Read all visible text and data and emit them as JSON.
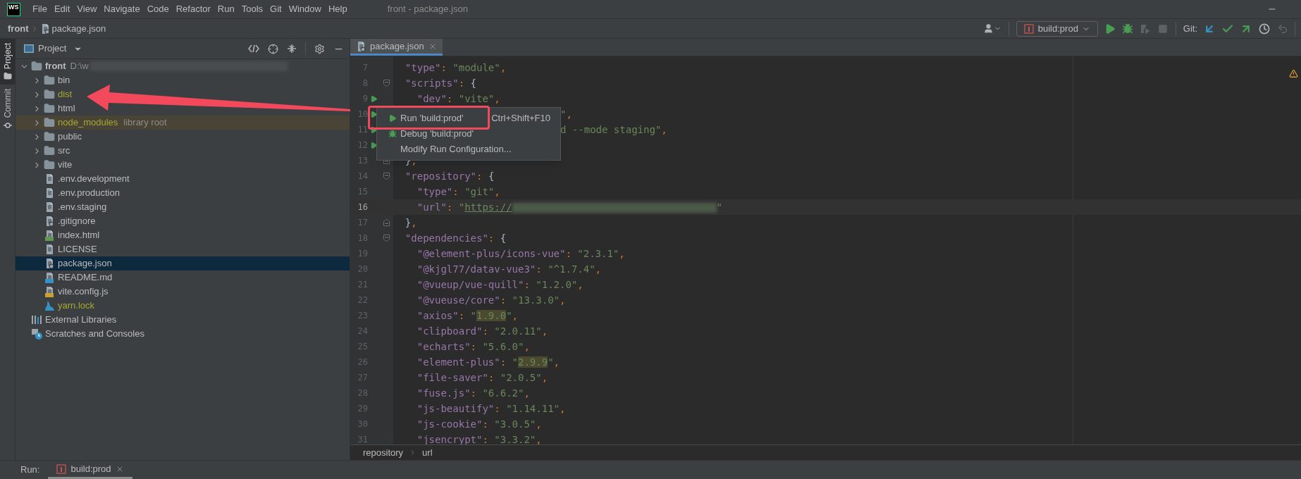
{
  "title_bar": {
    "logo": "WS",
    "menu": [
      "File",
      "Edit",
      "View",
      "Navigate",
      "Code",
      "Refactor",
      "Run",
      "Tools",
      "Git",
      "Window",
      "Help"
    ],
    "title": "front - package.json"
  },
  "nav_bar": {
    "breadcrumb": [
      "front",
      "package.json"
    ],
    "run_config": "build:prod",
    "git_label": "Git:",
    "actions": [
      {
        "kind": "run",
        "disabled": false
      },
      {
        "kind": "debug",
        "disabled": false
      },
      {
        "kind": "coverage",
        "disabled": true
      },
      {
        "kind": "stop",
        "disabled": true
      }
    ],
    "git_actions": [
      {
        "kind": "update",
        "disabled": false
      },
      {
        "kind": "commit",
        "disabled": false
      },
      {
        "kind": "push",
        "disabled": false
      },
      {
        "kind": "history",
        "disabled": false
      },
      {
        "kind": "rollback",
        "disabled": true
      }
    ]
  },
  "tool_windows": [
    {
      "label": "Project",
      "selected": true
    },
    {
      "label": "Commit",
      "selected": false
    }
  ],
  "project_panel": {
    "title": "Project",
    "tree": [
      {
        "label": "front",
        "kind": "root",
        "path": "D:\\w",
        "expanded": true,
        "selected": false,
        "ignored": false,
        "children": [
          {
            "label": "bin",
            "kind": "folder",
            "expanded": false,
            "selected": false,
            "ignored": false
          },
          {
            "label": "dist",
            "kind": "folder",
            "expanded": false,
            "selected": false,
            "ignored": true
          },
          {
            "label": "html",
            "kind": "folder",
            "expanded": false,
            "selected": false,
            "ignored": false
          },
          {
            "label": "node_modules",
            "kind": "folder",
            "expanded": false,
            "selected": false,
            "ignored": true,
            "note": "library root"
          },
          {
            "label": "public",
            "kind": "folder",
            "expanded": false,
            "selected": false,
            "ignored": false
          },
          {
            "label": "src",
            "kind": "folder",
            "expanded": false,
            "selected": false,
            "ignored": false
          },
          {
            "label": "vite",
            "kind": "folder",
            "expanded": false,
            "selected": false,
            "ignored": false
          },
          {
            "label": ".env.development",
            "kind": "text",
            "selected": false,
            "ignored": false
          },
          {
            "label": ".env.production",
            "kind": "text",
            "selected": false,
            "ignored": false
          },
          {
            "label": ".env.staging",
            "kind": "text",
            "selected": false,
            "ignored": false
          },
          {
            "label": ".gitignore",
            "kind": "gitignore",
            "selected": false,
            "ignored": false
          },
          {
            "label": "index.html",
            "kind": "html",
            "selected": false,
            "ignored": false
          },
          {
            "label": "LICENSE",
            "kind": "text",
            "selected": false,
            "ignored": false
          },
          {
            "label": "package.json",
            "kind": "json",
            "selected": true,
            "ignored": false
          },
          {
            "label": "README.md",
            "kind": "markdown",
            "selected": false,
            "ignored": false
          },
          {
            "label": "vite.config.js",
            "kind": "js",
            "selected": false,
            "ignored": false
          },
          {
            "label": "yarn.lock",
            "kind": "yarn",
            "selected": false,
            "ignored": true
          }
        ]
      },
      {
        "label": "External Libraries",
        "kind": "libraries",
        "selected": false,
        "ignored": false
      },
      {
        "label": "Scratches and Consoles",
        "kind": "scratches",
        "selected": false,
        "ignored": false
      }
    ]
  },
  "editor": {
    "tabs": [
      {
        "label": "package.json",
        "selected": true
      }
    ],
    "lines": [
      {
        "number": "7",
        "kind": "code",
        "run": false,
        "current": false,
        "fold_start": false,
        "fold_end": false,
        "tokens": [
          {
            "kind": "key",
            "text": "  \"type\""
          },
          {
            "kind": "punct",
            "text": ": "
          },
          {
            "kind": "string",
            "text": "\"module\""
          },
          {
            "kind": "punct",
            "text": ","
          }
        ]
      },
      {
        "number": "8",
        "kind": "code",
        "run": false,
        "current": false,
        "fold_start": true,
        "fold_end": false,
        "tokens": [
          {
            "kind": "key",
            "text": "  \"scripts\""
          },
          {
            "kind": "punct",
            "text": ": "
          },
          {
            "kind": "brace",
            "text": "{"
          }
        ]
      },
      {
        "number": "9",
        "kind": "code",
        "run": true,
        "current": false,
        "fold_start": false,
        "fold_end": false,
        "tokens": [
          {
            "kind": "key",
            "text": "    \"dev\""
          },
          {
            "kind": "punct",
            "text": ": "
          },
          {
            "kind": "string",
            "text": "\"vite\""
          },
          {
            "kind": "punct",
            "text": ","
          }
        ]
      },
      {
        "number": "10",
        "kind": "tail",
        "run": true,
        "current": false,
        "fold_start": false,
        "fold_end": false,
        "tokens": [
          {
            "kind": "string",
            "text": "\""
          },
          {
            "kind": "punct",
            "text": ","
          }
        ]
      },
      {
        "number": "11",
        "kind": "tail",
        "run": true,
        "current": false,
        "fold_start": false,
        "fold_end": false,
        "tokens": [
          {
            "kind": "string",
            "text": "d --mode staging\""
          },
          {
            "kind": "punct",
            "text": ","
          }
        ]
      },
      {
        "number": "12",
        "kind": "covered",
        "run": true,
        "current": false,
        "fold_start": false,
        "fold_end": false
      },
      {
        "number": "13",
        "kind": "code",
        "run": false,
        "current": false,
        "fold_start": false,
        "fold_end": true,
        "tokens": [
          {
            "kind": "brace",
            "text": "  }"
          },
          {
            "kind": "punct",
            "text": ","
          }
        ]
      },
      {
        "number": "14",
        "kind": "code",
        "run": false,
        "current": false,
        "fold_start": true,
        "fold_end": false,
        "tokens": [
          {
            "kind": "key",
            "text": "  \"repository\""
          },
          {
            "kind": "punct",
            "text": ": "
          },
          {
            "kind": "brace",
            "text": "{"
          }
        ]
      },
      {
        "number": "15",
        "kind": "code",
        "run": false,
        "current": false,
        "fold_start": false,
        "fold_end": false,
        "tokens": [
          {
            "kind": "key",
            "text": "    \"type\""
          },
          {
            "kind": "punct",
            "text": ": "
          },
          {
            "kind": "string",
            "text": "\"git\""
          },
          {
            "kind": "punct",
            "text": ","
          }
        ]
      },
      {
        "number": "16",
        "kind": "code",
        "run": false,
        "current": true,
        "fold_start": false,
        "fold_end": false,
        "tokens": [
          {
            "kind": "key",
            "text": "    \"url\""
          },
          {
            "kind": "punct",
            "text": ": "
          },
          {
            "kind": "string",
            "text": "\""
          },
          {
            "kind": "link",
            "text": "https://"
          },
          {
            "kind": "redacted"
          },
          {
            "kind": "string",
            "text": "\""
          }
        ]
      },
      {
        "number": "17",
        "kind": "code",
        "run": false,
        "current": false,
        "fold_start": false,
        "fold_end": true,
        "tokens": [
          {
            "kind": "brace",
            "text": "  }"
          },
          {
            "kind": "punct",
            "text": ","
          }
        ]
      },
      {
        "number": "18",
        "kind": "code",
        "run": false,
        "current": false,
        "fold_start": true,
        "fold_end": false,
        "tokens": [
          {
            "kind": "key",
            "text": "  \"dependencies\""
          },
          {
            "kind": "punct",
            "text": ": "
          },
          {
            "kind": "brace",
            "text": "{"
          }
        ]
      },
      {
        "number": "19",
        "kind": "code",
        "run": false,
        "current": false,
        "tokens": [
          {
            "kind": "key",
            "text": "    \"@element-plus/icons-vue\""
          },
          {
            "kind": "punct",
            "text": ": "
          },
          {
            "kind": "string",
            "text": "\"2.3.1\""
          },
          {
            "kind": "punct",
            "text": ","
          }
        ]
      },
      {
        "number": "20",
        "kind": "code",
        "run": false,
        "current": false,
        "tokens": [
          {
            "kind": "key",
            "text": "    \"@kjgl77/datav-vue3\""
          },
          {
            "kind": "punct",
            "text": ": "
          },
          {
            "kind": "string",
            "text": "\"^1.7.4\""
          },
          {
            "kind": "punct",
            "text": ","
          }
        ]
      },
      {
        "number": "21",
        "kind": "code",
        "run": false,
        "current": false,
        "tokens": [
          {
            "kind": "key",
            "text": "    \"@vueup/vue-quill\""
          },
          {
            "kind": "punct",
            "text": ": "
          },
          {
            "kind": "string",
            "text": "\"1.2.0\""
          },
          {
            "kind": "punct",
            "text": ","
          }
        ]
      },
      {
        "number": "22",
        "kind": "code",
        "run": false,
        "current": false,
        "tokens": [
          {
            "kind": "key",
            "text": "    \"@vueuse/core\""
          },
          {
            "kind": "punct",
            "text": ": "
          },
          {
            "kind": "string",
            "text": "\"13.3.0\""
          },
          {
            "kind": "punct",
            "text": ","
          }
        ]
      },
      {
        "number": "23",
        "kind": "code",
        "run": false,
        "current": false,
        "tokens": [
          {
            "kind": "key",
            "text": "    \"axios\""
          },
          {
            "kind": "punct",
            "text": ": "
          },
          {
            "kind": "string",
            "text": "\""
          },
          {
            "kind": "marked",
            "text": "1.9.0"
          },
          {
            "kind": "string",
            "text": "\""
          },
          {
            "kind": "punct",
            "text": ","
          }
        ]
      },
      {
        "number": "24",
        "kind": "code",
        "run": false,
        "current": false,
        "tokens": [
          {
            "kind": "key",
            "text": "    \"clipboard\""
          },
          {
            "kind": "punct",
            "text": ": "
          },
          {
            "kind": "string",
            "text": "\"2.0.11\""
          },
          {
            "kind": "punct",
            "text": ","
          }
        ]
      },
      {
        "number": "25",
        "kind": "code",
        "run": false,
        "current": false,
        "tokens": [
          {
            "kind": "key",
            "text": "    \"echarts\""
          },
          {
            "kind": "punct",
            "text": ": "
          },
          {
            "kind": "string",
            "text": "\"5.6.0\""
          },
          {
            "kind": "punct",
            "text": ","
          }
        ]
      },
      {
        "number": "26",
        "kind": "code",
        "run": false,
        "current": false,
        "tokens": [
          {
            "kind": "key",
            "text": "    \"element-plus\""
          },
          {
            "kind": "punct",
            "text": ": "
          },
          {
            "kind": "string",
            "text": "\""
          },
          {
            "kind": "marked",
            "text": "2.9.9"
          },
          {
            "kind": "string",
            "text": "\""
          },
          {
            "kind": "punct",
            "text": ","
          }
        ]
      },
      {
        "number": "27",
        "kind": "code",
        "run": false,
        "current": false,
        "tokens": [
          {
            "kind": "key",
            "text": "    \"file-saver\""
          },
          {
            "kind": "punct",
            "text": ": "
          },
          {
            "kind": "string",
            "text": "\"2.0.5\""
          },
          {
            "kind": "punct",
            "text": ","
          }
        ]
      },
      {
        "number": "28",
        "kind": "code",
        "run": false,
        "current": false,
        "tokens": [
          {
            "kind": "key",
            "text": "    \"fuse.js\""
          },
          {
            "kind": "punct",
            "text": ": "
          },
          {
            "kind": "string",
            "text": "\"6.6.2\""
          },
          {
            "kind": "punct",
            "text": ","
          }
        ]
      },
      {
        "number": "29",
        "kind": "code",
        "run": false,
        "current": false,
        "tokens": [
          {
            "kind": "key",
            "text": "    \"js-beautify\""
          },
          {
            "kind": "punct",
            "text": ": "
          },
          {
            "kind": "string",
            "text": "\"1.14.11\""
          },
          {
            "kind": "punct",
            "text": ","
          }
        ]
      },
      {
        "number": "30",
        "kind": "code",
        "run": false,
        "current": false,
        "tokens": [
          {
            "kind": "key",
            "text": "    \"js-cookie\""
          },
          {
            "kind": "punct",
            "text": ": "
          },
          {
            "kind": "string",
            "text": "\"3.0.5\""
          },
          {
            "kind": "punct",
            "text": ","
          }
        ]
      },
      {
        "number": "31",
        "kind": "code",
        "run": false,
        "current": false,
        "tokens": [
          {
            "kind": "key",
            "text": "    \"jsencrypt\""
          },
          {
            "kind": "punct",
            "text": ": "
          },
          {
            "kind": "string",
            "text": "\"3.3.2\""
          },
          {
            "kind": "punct",
            "text": ","
          }
        ]
      }
    ],
    "context_menu": [
      {
        "kind": "run",
        "label": "Run 'build:prod'",
        "shortcut": "Ctrl+Shift+F10"
      },
      {
        "kind": "debug",
        "label": "Debug 'build:prod'"
      },
      {
        "kind": "plain",
        "label": "Modify Run Configuration..."
      }
    ],
    "breadcrumb": [
      "repository",
      "url"
    ]
  },
  "run_bar": {
    "label": "Run:",
    "tabs": [
      {
        "label": "build:prod",
        "selected": true
      }
    ]
  }
}
